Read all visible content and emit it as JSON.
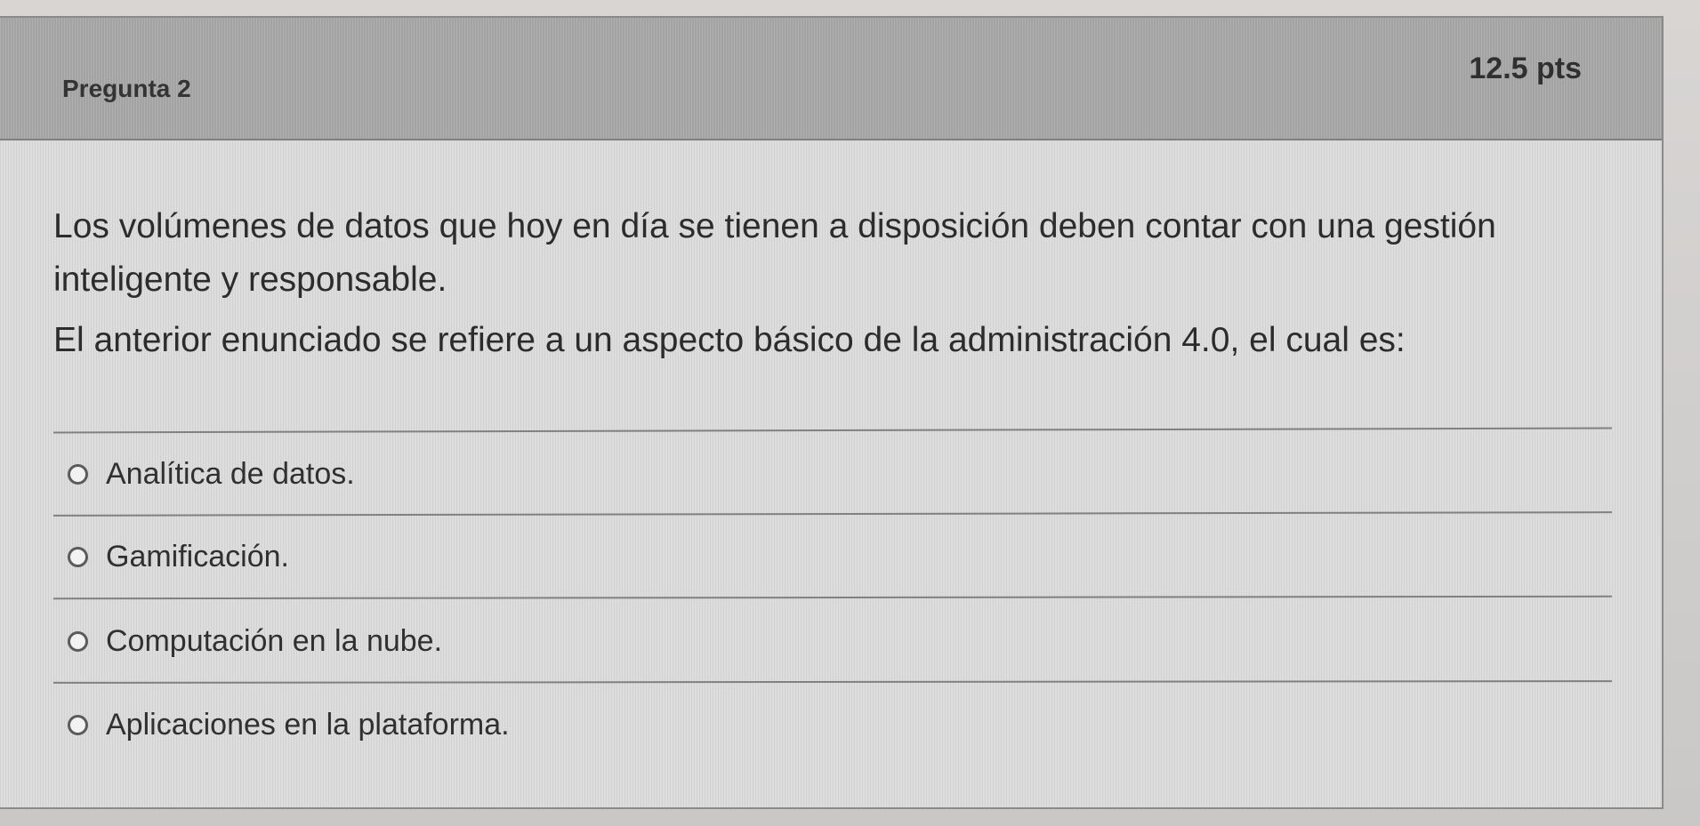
{
  "question": {
    "title": "Pregunta 2",
    "points": "12.5 pts",
    "stem_lines": [
      "Los volúmenes de datos que hoy en día se tienen a disposición deben contar con una gestión",
      "inteligente y responsable."
    ],
    "prompt": "El anterior enunciado se refiere a un aspecto básico de la administración 4.0, el cual es:",
    "options": [
      {
        "label": "Analítica de datos."
      },
      {
        "label": "Gamificación."
      },
      {
        "label": "Computación en la nube."
      },
      {
        "label": "Aplicaciones en la plataforma."
      }
    ]
  },
  "colors": {
    "card_background": "#dcdcdc",
    "header_background": "#a8a8a8",
    "text": "#2d2d2d",
    "border": "#8a8a8a"
  },
  "icons": {
    "radio": "radio-button-icon"
  }
}
